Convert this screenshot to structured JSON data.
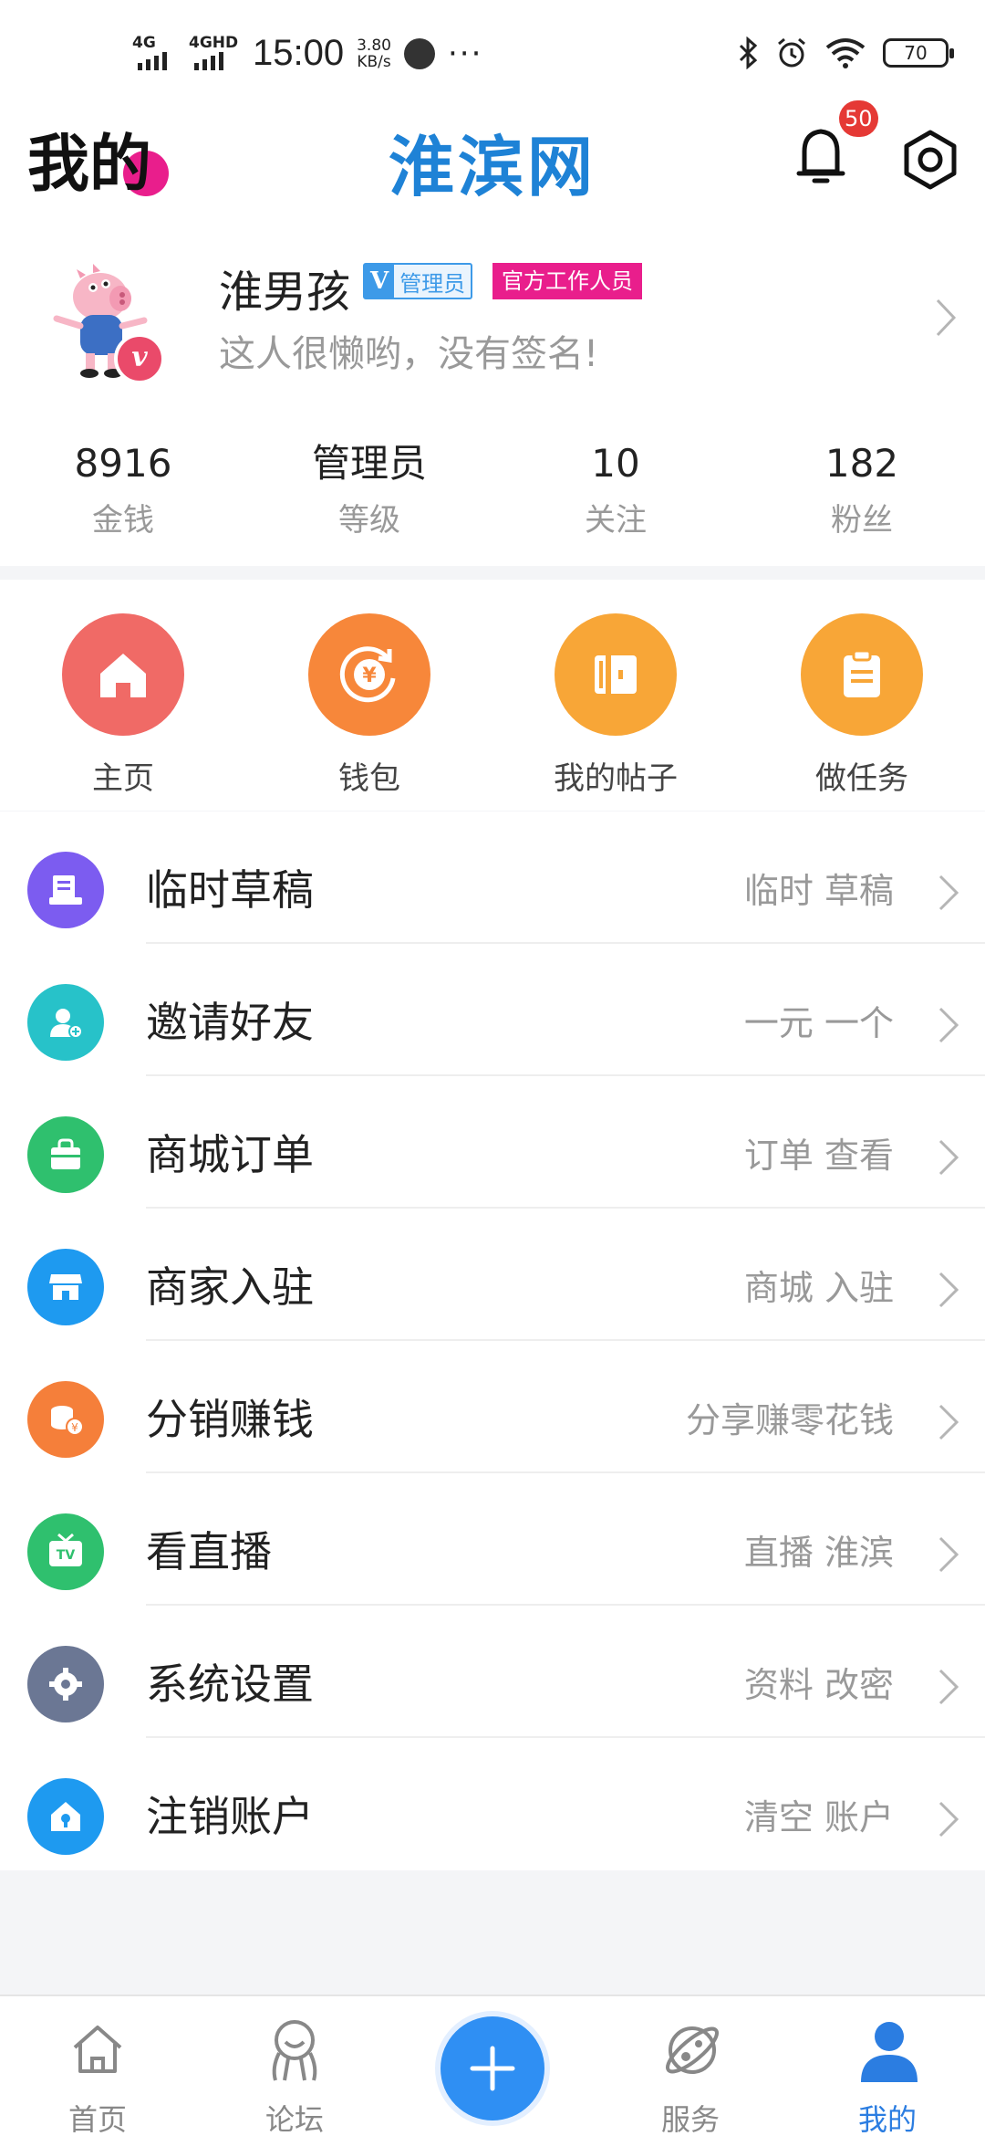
{
  "status_bar": {
    "net1": "4G",
    "net2": "4GHD",
    "time": "15:00",
    "speed_value": "3.80",
    "speed_unit": "KB/s",
    "more": "···",
    "battery": "70"
  },
  "header": {
    "title": "我的",
    "brand": "淮滨网",
    "notification_count": "50"
  },
  "profile": {
    "username": "淮男孩",
    "admin_tag_v": "V",
    "admin_tag_text": "管理员",
    "staff_tag": "官方工作人员",
    "signature": "这人很懒哟，没有签名!",
    "avatar_badge": "v"
  },
  "stats": [
    {
      "value": "8916",
      "label": "金钱"
    },
    {
      "value": "管理员",
      "label": "等级"
    },
    {
      "value": "10",
      "label": "关注"
    },
    {
      "value": "182",
      "label": "粉丝"
    }
  ],
  "shortcuts": [
    {
      "label": "主页",
      "color": "#f06a66",
      "icon": "home-icon"
    },
    {
      "label": "钱包",
      "color": "#f7873a",
      "icon": "wallet-icon"
    },
    {
      "label": "我的帖子",
      "color": "#f8a637",
      "icon": "posts-icon"
    },
    {
      "label": "做任务",
      "color": "#f8a637",
      "icon": "task-icon"
    }
  ],
  "menu": [
    {
      "title": "临时草稿",
      "sub": "临时 草稿",
      "color": "#7c5cf0",
      "icon": "draft-icon"
    },
    {
      "title": "邀请好友",
      "sub": "一元 一个",
      "color": "#27c2c9",
      "icon": "invite-user-icon"
    },
    {
      "title": "商城订单",
      "sub": "订单 查看",
      "color": "#2fc06e",
      "icon": "shopping-bag-icon"
    },
    {
      "title": "商家入驻",
      "sub": "商城 入驻",
      "color": "#1e9af0",
      "icon": "store-icon"
    },
    {
      "title": "分销赚钱",
      "sub": "分享赚零花钱",
      "color": "#f57f3a",
      "icon": "coins-icon"
    },
    {
      "title": "看直播",
      "sub": "直播 淮滨",
      "color": "#2fc06e",
      "icon": "tv-icon"
    },
    {
      "title": "系统设置",
      "sub": "资料 改密",
      "color": "#6b7794",
      "icon": "gear-icon"
    },
    {
      "title": "注销账户",
      "sub": "清空 账户",
      "color": "#1e9af0",
      "icon": "lock-house-icon"
    }
  ],
  "bottom_nav": {
    "home": "首页",
    "forum": "论坛",
    "service": "服务",
    "mine": "我的",
    "active_color": "#2b7de1"
  }
}
